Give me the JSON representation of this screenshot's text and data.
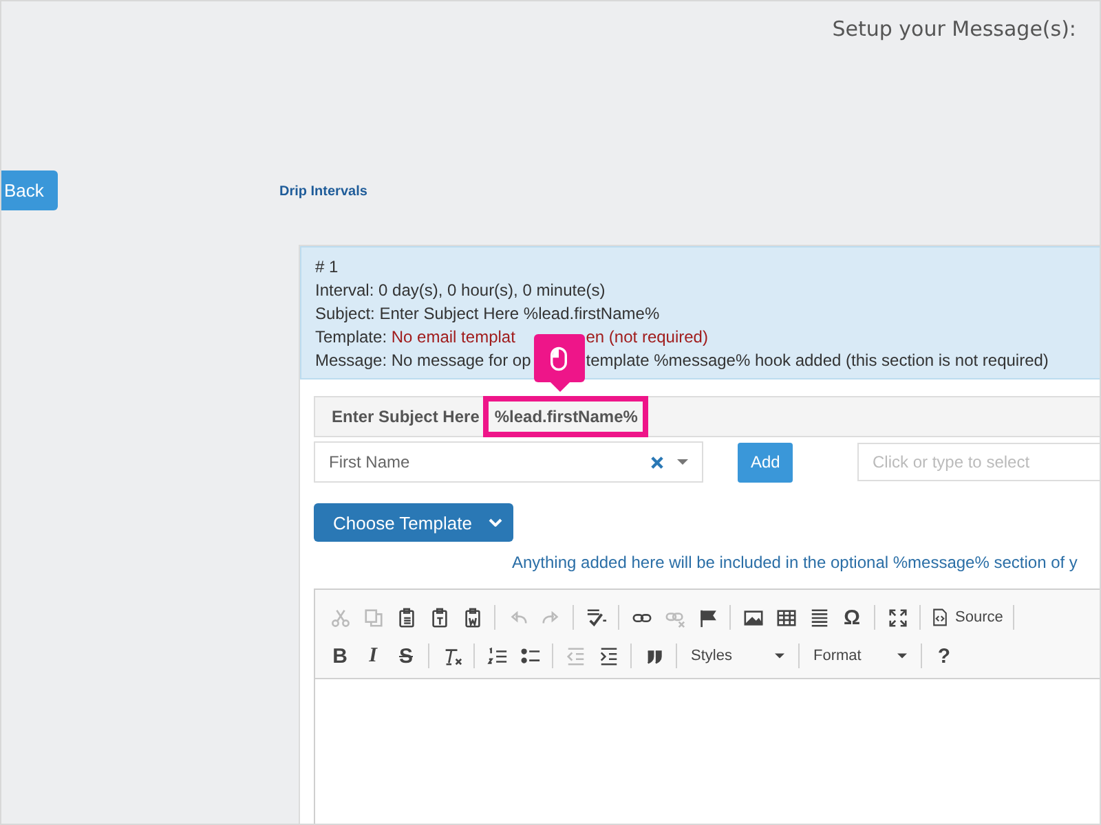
{
  "header": {
    "title": "Setup your Message(s):"
  },
  "back_button": {
    "label": "Back"
  },
  "section_label": "Drip Intervals",
  "summary": {
    "number": "# 1",
    "interval": "Interval: 0 day(s), 0 hour(s), 0 minute(s)",
    "subject": "Subject: Enter Subject Here %lead.firstName%",
    "template_label": "Template:",
    "template_before": "No email templat",
    "template_after": "en (not required)",
    "message_before": "Message: No message for op",
    "message_after": "template %message% hook added (this section is not required)"
  },
  "subject_field": {
    "value": "Enter Subject Here",
    "highlight": "%lead.firstName%"
  },
  "merge_field": {
    "value": "First Name"
  },
  "add_button": {
    "label": "Add"
  },
  "tag_field": {
    "placeholder": "Click or type to select"
  },
  "template_button": {
    "label": "Choose Template"
  },
  "hint": "Anything added here will be included in the optional %message% section of y",
  "editor": {
    "toolbar": [
      [
        {
          "kind": "icon",
          "disabled": true
        },
        {
          "kind": "icon",
          "disabled": true
        },
        {
          "kind": "icon",
          "disabled": false
        },
        {
          "kind": "icon",
          "disabled": false
        },
        {
          "kind": "icon",
          "disabled": false
        },
        {
          "kind": "separator"
        },
        {
          "kind": "icon",
          "disabled": true
        },
        {
          "kind": "icon",
          "disabled": true
        },
        {
          "kind": "separator"
        },
        {
          "kind": "icon",
          "disabled": false
        },
        {
          "kind": "separator"
        },
        {
          "kind": "icon",
          "disabled": false
        },
        {
          "kind": "icon",
          "disabled": true
        },
        {
          "kind": "icon",
          "disabled": false
        },
        {
          "kind": "separator"
        },
        {
          "kind": "icon",
          "disabled": false
        },
        {
          "kind": "icon",
          "disabled": false
        },
        {
          "kind": "icon",
          "disabled": false
        },
        {
          "kind": "glyph",
          "text": "Ω",
          "disabled": false
        },
        {
          "kind": "separator"
        },
        {
          "kind": "icon",
          "disabled": false
        },
        {
          "kind": "separator"
        },
        {
          "kind": "label-button",
          "text": "Source",
          "disabled": false
        },
        {
          "kind": "separator"
        }
      ],
      [
        {
          "kind": "glyph",
          "text": "B",
          "disabled": false
        },
        {
          "kind": "glyph",
          "text": "I",
          "disabled": false
        },
        {
          "kind": "glyph",
          "text": "S",
          "disabled": false
        },
        {
          "kind": "separator"
        },
        {
          "kind": "icon",
          "disabled": false
        },
        {
          "kind": "separator"
        },
        {
          "kind": "icon",
          "disabled": false
        },
        {
          "kind": "icon",
          "disabled": false
        },
        {
          "kind": "separator"
        },
        {
          "kind": "icon",
          "disabled": true
        },
        {
          "kind": "icon",
          "disabled": false
        },
        {
          "kind": "separator"
        },
        {
          "kind": "icon",
          "disabled": false
        },
        {
          "kind": "separator"
        },
        {
          "kind": "combo",
          "text": "Styles",
          "disabled": false
        },
        {
          "kind": "separator"
        },
        {
          "kind": "combo",
          "text": "Format",
          "disabled": false
        },
        {
          "kind": "separator"
        },
        {
          "kind": "glyph",
          "text": "?",
          "disabled": false
        }
      ]
    ]
  }
}
